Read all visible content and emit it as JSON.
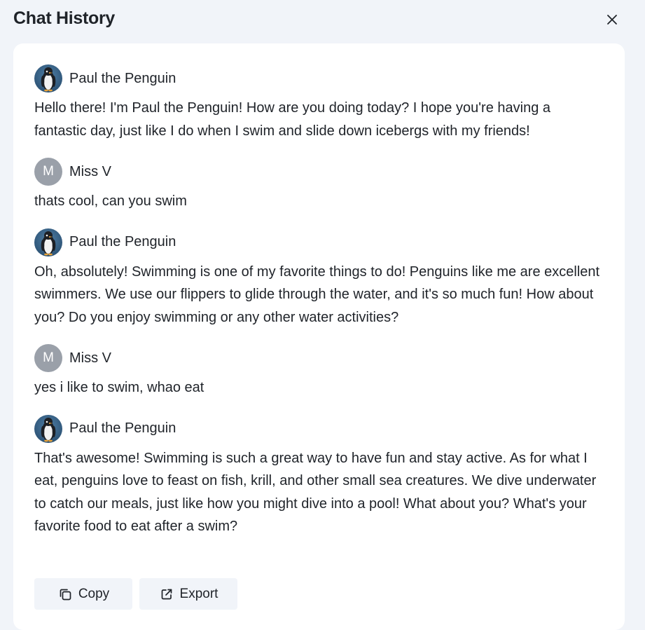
{
  "header": {
    "title": "Chat History",
    "close_icon": "close-icon"
  },
  "messages": [
    {
      "sender": "Paul the Penguin",
      "avatar": "penguin-avatar",
      "text": "Hello there! I'm Paul the Penguin! How are you doing today? I hope you're having a fantastic day, just like I do when I swim and slide down icebergs with my friends!"
    },
    {
      "sender": "Miss V",
      "avatar_initial": "M",
      "text": "thats cool, can you swim"
    },
    {
      "sender": "Paul the Penguin",
      "avatar": "penguin-avatar",
      "text": "Oh, absolutely! Swimming is one of my favorite things to do! Penguins like me are excellent swimmers. We use our flippers to glide through the water, and it's so much fun! How about you? Do you enjoy swimming or any other water activities?"
    },
    {
      "sender": "Miss V",
      "avatar_initial": "M",
      "text": "yes i like to swim, whao eat"
    },
    {
      "sender": "Paul the Penguin",
      "avatar": "penguin-avatar",
      "text": "That's awesome! Swimming is such a great way to have fun and stay active. As for what I eat, penguins love to feast on fish, krill, and other small sea creatures. We dive underwater to catch our meals, just like how you might dive into a pool! What about you? What's your favorite food to eat after a swim?"
    }
  ],
  "actions": {
    "copy_label": "Copy",
    "copy_icon": "copy-icon",
    "export_label": "Export",
    "export_icon": "external-link-icon"
  },
  "colors": {
    "background": "#f1f4f9",
    "card": "#ffffff",
    "text": "#1f2329",
    "user_avatar": "#9aa0a9",
    "penguin_avatar": "#2f5679"
  }
}
